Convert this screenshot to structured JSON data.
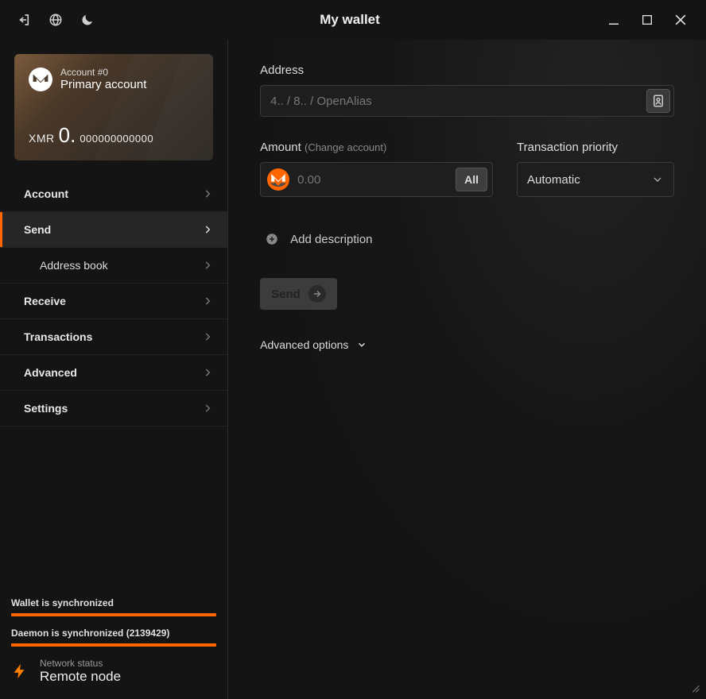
{
  "titlebar": {
    "title": "My wallet"
  },
  "account_card": {
    "account_num": "Account #0",
    "account_name": "Primary account",
    "currency": "XMR",
    "balance_int": "0.",
    "balance_frac": "000000000000"
  },
  "nav": {
    "account": "Account",
    "send": "Send",
    "address_book": "Address book",
    "receive": "Receive",
    "transactions": "Transactions",
    "advanced": "Advanced",
    "settings": "Settings"
  },
  "sync": {
    "wallet": "Wallet is synchronized",
    "daemon": "Daemon is synchronized (2139429)"
  },
  "network": {
    "label": "Network status",
    "value": "Remote node"
  },
  "form": {
    "address_label": "Address",
    "address_placeholder": "4.. / 8.. / OpenAlias",
    "amount_label": "Amount",
    "change_account": "(Change account)",
    "amount_placeholder": "0.00",
    "all_button": "All",
    "priority_label": "Transaction priority",
    "priority_value": "Automatic",
    "add_description": "Add description",
    "send_button": "Send",
    "advanced_options": "Advanced options"
  }
}
